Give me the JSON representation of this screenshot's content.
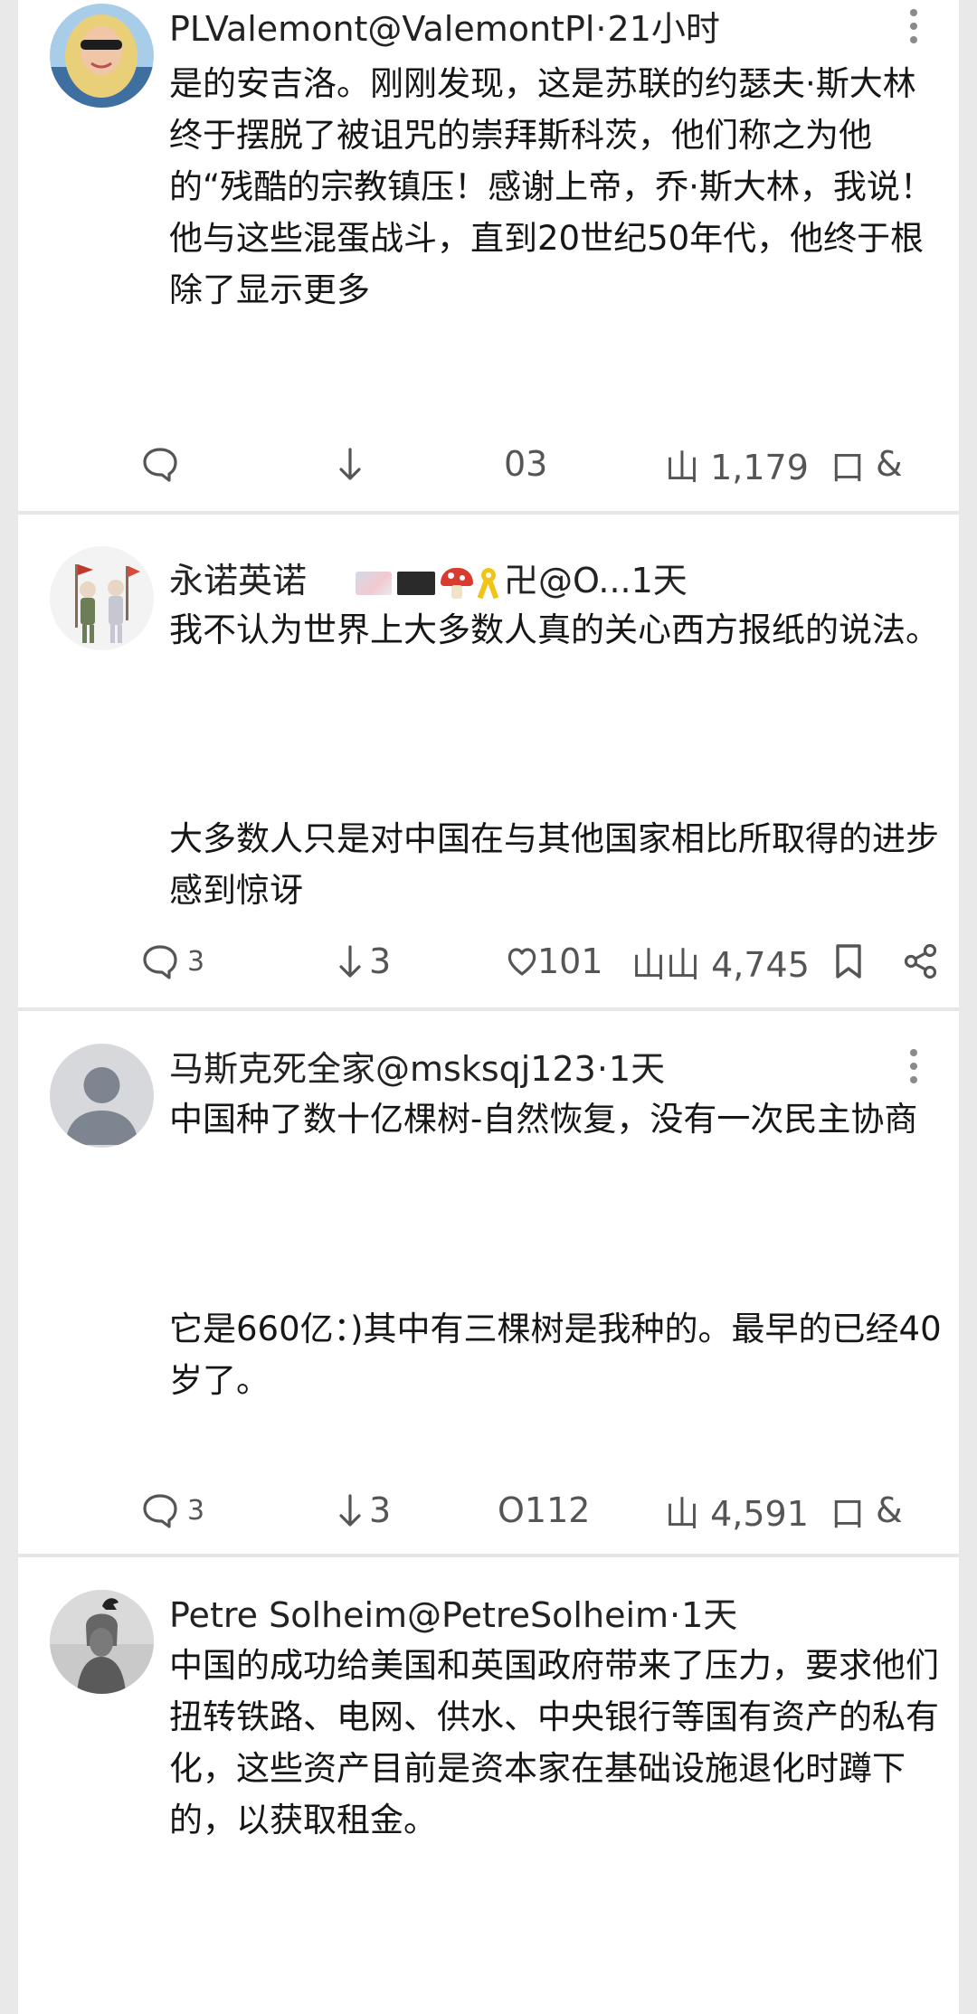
{
  "posts": [
    {
      "author": "PLValemont@ValemontPl",
      "sep": "·",
      "time": "21小时",
      "paragraphs": [
        "是的安吉洛。刚刚发现，这是苏联的约瑟夫·斯大林终于摆脱了被诅咒的崇拜斯科茨，他们称之为他的“残酷的宗教镇压！感谢上帝，乔·斯大林，我说！他与这些混蛋战斗，直到20世纪50年代，他终于根除了显示更多"
      ],
      "actions": {
        "reply": "",
        "retweet": "",
        "like": "03",
        "views": "山 1,179",
        "bookmark": "口",
        "share": "&"
      }
    },
    {
      "author_name": "永诺英诺",
      "handle": "卍@O...",
      "time": "1天",
      "paragraphs": [
        "我不认为世界上大多数人真的关心西方报纸的说法。",
        "大多数人只是对中国在与其他国家相比所取得的进步感到惊讶"
      ],
      "actions": {
        "reply": "3",
        "retweet": "3",
        "like": "101",
        "views": "山山 4,745"
      }
    },
    {
      "author": "马斯克死全家@msksqj123",
      "sep": "·",
      "time": "1天",
      "paragraphs": [
        "中国种了数十亿棵树-自然恢复，没有一次民主协商",
        "它是660亿：)其中有三棵树是我种的。最早的已经40岁了。"
      ],
      "actions": {
        "reply": "3",
        "retweet": "3",
        "like": "O112",
        "views": "山 4,591",
        "bookmark": "口",
        "share": "&"
      }
    },
    {
      "author": "Petre Solheim@PetreSolheim",
      "sep": "·",
      "time": "1天",
      "paragraphs": [
        "中国的成功给美国和英国政府带来了压力，要求他们扭转铁路、电网、供水、中央银行等国有资产的私有化，这些资产目前是资本家在基础设施退化时蹲下的，以获取租金。"
      ]
    }
  ],
  "colors": {
    "divider": "#e6e6e6",
    "text": "#161616",
    "muted": "#555555"
  },
  "icons": [
    "reply-icon",
    "retweet-icon",
    "like-icon",
    "views-icon",
    "bookmark-icon",
    "share-icon",
    "more-icon"
  ]
}
